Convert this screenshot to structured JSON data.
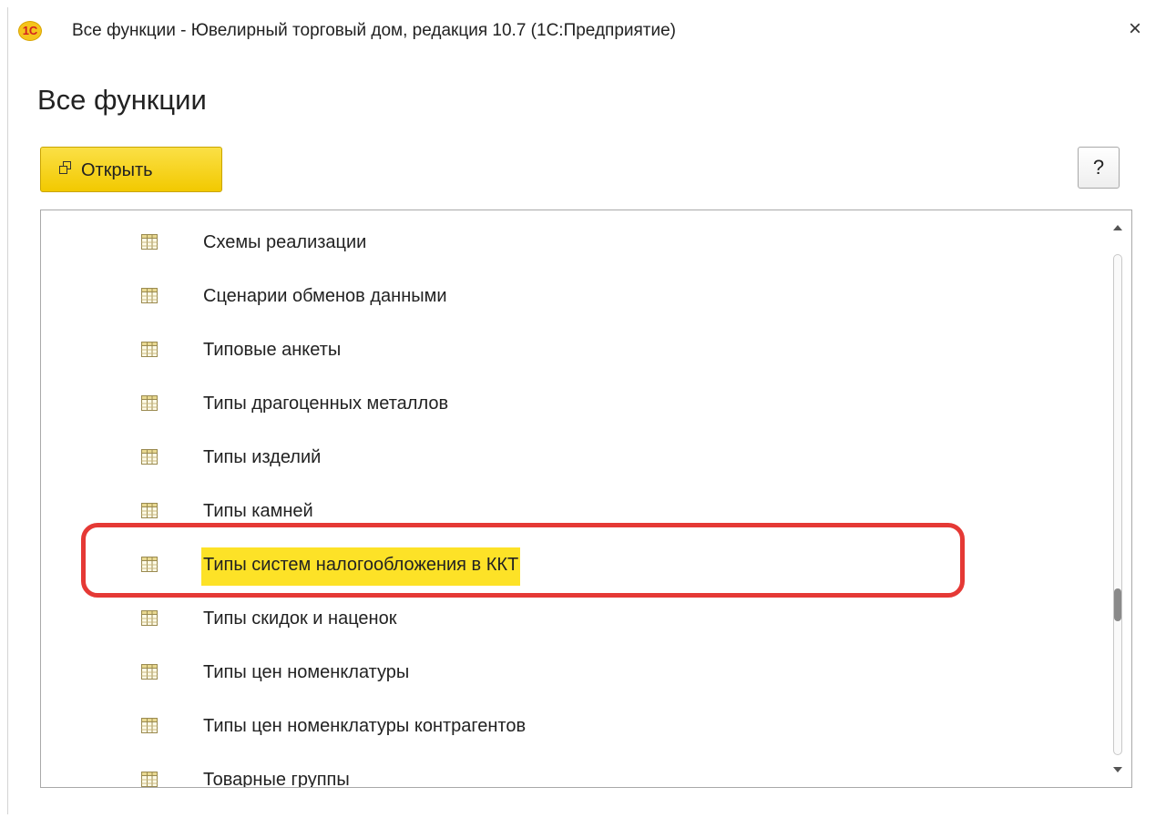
{
  "window": {
    "title": "Все функции - Ювелирный торговый дом, редакция 10.7  (1С:Предприятие)",
    "logo_text": "1С",
    "close_glyph": "×"
  },
  "page": {
    "title": "Все функции"
  },
  "toolbar": {
    "open_label": "Открыть",
    "help_label": "?"
  },
  "list": {
    "items": [
      {
        "label": "Схемы реализации",
        "icon": "catalog-table-icon"
      },
      {
        "label": "Сценарии обменов данными",
        "icon": "catalog-table-icon"
      },
      {
        "label": "Типовые анкеты",
        "icon": "catalog-table-icon"
      },
      {
        "label": "Типы драгоценных металлов",
        "icon": "catalog-table-icon"
      },
      {
        "label": "Типы изделий",
        "icon": "catalog-table-icon"
      },
      {
        "label": "Типы камней",
        "icon": "catalog-table-icon"
      },
      {
        "label": "Типы систем налогообложения в ККТ",
        "icon": "catalog-table-icon",
        "selected": true
      },
      {
        "label": "Типы скидок и наценок",
        "icon": "catalog-table-icon"
      },
      {
        "label": "Типы цен номенклатуры",
        "icon": "catalog-table-icon"
      },
      {
        "label": "Типы цен номенклатуры контрагентов",
        "icon": "catalog-table-icon"
      },
      {
        "label": "Товарные группы",
        "icon": "catalog-table-icon"
      }
    ]
  },
  "colors": {
    "accent_button": "#f2c900",
    "selection_highlight": "#fde227",
    "annotation_box": "#e53935"
  }
}
